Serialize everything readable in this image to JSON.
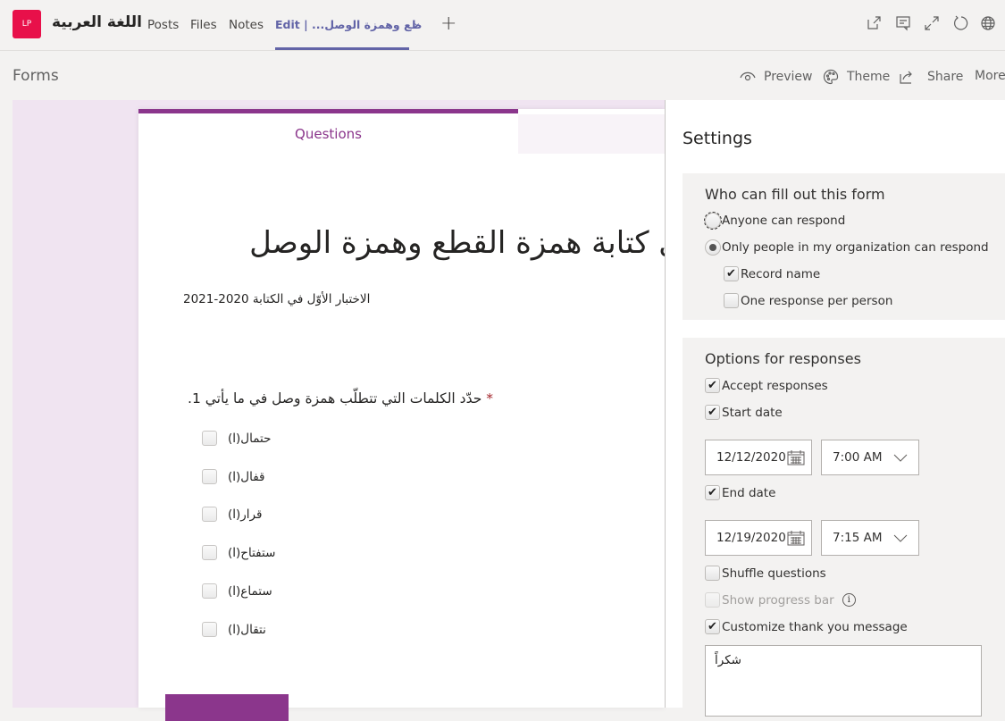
{
  "topbar": {
    "avatar_initials": "LP",
    "team_name": "اللغة العربية",
    "tabs": [
      {
        "label": "Posts"
      },
      {
        "label": "Files"
      },
      {
        "label": "Notes"
      },
      {
        "label": "Edit | ...طع وهمزة الوصل",
        "active": true
      }
    ],
    "add_tab_label": "+",
    "icons": [
      "open-external-icon",
      "chat-icon",
      "expand-icon",
      "refresh-icon",
      "globe-icon"
    ]
  },
  "subbar": {
    "title": "Forms",
    "commands": [
      {
        "label": "Preview",
        "icon": "eye-icon"
      },
      {
        "label": "Theme",
        "icon": "palette-icon"
      },
      {
        "label": "Share",
        "icon": "share-icon"
      },
      {
        "label": "More"
      }
    ]
  },
  "form": {
    "tab_questions": "Questions",
    "title": "ي كتابة همزة القطع وهمزة الوصل",
    "subtitle": "الاختبار الأوّل في الكتابة 2020-2021",
    "question": {
      "number": "1.",
      "text": "حدّد الكلمات التي تتطلّب همزة وصل في ما يأتي",
      "required_mark": "*",
      "options": [
        "حتمال(ا)",
        "قفال(ا)",
        "قرار(ا)",
        "ستفتاح(ا)",
        "ستماع(ا)",
        "نتقال(ا)"
      ]
    },
    "accent_color": "#8b368c"
  },
  "settings": {
    "title": "Settings",
    "who": {
      "heading": "Who can fill out this form",
      "anyone": {
        "label": "Anyone can respond",
        "selected": false
      },
      "org_only": {
        "label": "Only people in my organization can respond",
        "selected": true
      },
      "record_name": {
        "label": "Record name",
        "checked": true
      },
      "one_response": {
        "label": "One response per person",
        "checked": false
      }
    },
    "options": {
      "heading": "Options for responses",
      "accept": {
        "label": "Accept responses",
        "checked": true
      },
      "start_date": {
        "label": "Start date",
        "checked": true,
        "date": "12/12/2020",
        "time": "7:00 AM"
      },
      "end_date": {
        "label": "End date",
        "checked": true,
        "date": "12/19/2020",
        "time": "7:15 AM"
      },
      "shuffle": {
        "label": "Shuffle questions",
        "checked": false
      },
      "progress": {
        "label": "Show progress bar",
        "checked": false,
        "disabled": true,
        "info": "i"
      },
      "thank_you": {
        "label": "Customize thank you message",
        "checked": true,
        "message": "شكراً"
      }
    }
  }
}
